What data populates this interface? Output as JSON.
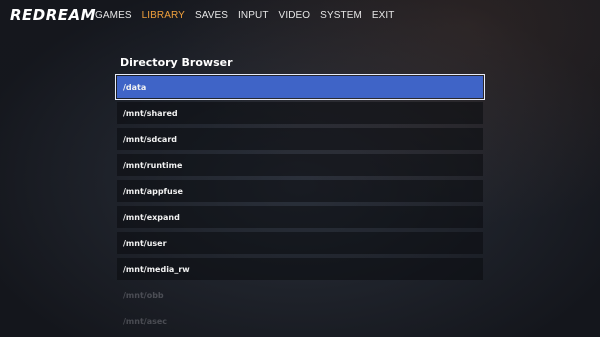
{
  "app": {
    "logo": "REDREAM"
  },
  "nav": {
    "items": [
      {
        "label": "GAMES",
        "active": false
      },
      {
        "label": "LIBRARY",
        "active": true
      },
      {
        "label": "SAVES",
        "active": false
      },
      {
        "label": "INPUT",
        "active": false
      },
      {
        "label": "VIDEO",
        "active": false
      },
      {
        "label": "SYSTEM",
        "active": false
      },
      {
        "label": "EXIT",
        "active": false
      }
    ]
  },
  "browser": {
    "title": "Directory Browser",
    "entries": [
      {
        "label": "/data",
        "state": "selected"
      },
      {
        "label": "/mnt/shared",
        "state": "normal"
      },
      {
        "label": "/mnt/sdcard",
        "state": "normal"
      },
      {
        "label": "/mnt/runtime",
        "state": "normal"
      },
      {
        "label": "/mnt/appfuse",
        "state": "normal"
      },
      {
        "label": "/mnt/expand",
        "state": "normal"
      },
      {
        "label": "/mnt/user",
        "state": "normal"
      },
      {
        "label": "/mnt/media_rw",
        "state": "normal"
      },
      {
        "label": "/mnt/obb",
        "state": "faded"
      },
      {
        "label": "/mnt/asec",
        "state": "faded"
      }
    ]
  },
  "colors": {
    "accent": "#f0a03c",
    "selection": "#3f64c7"
  }
}
